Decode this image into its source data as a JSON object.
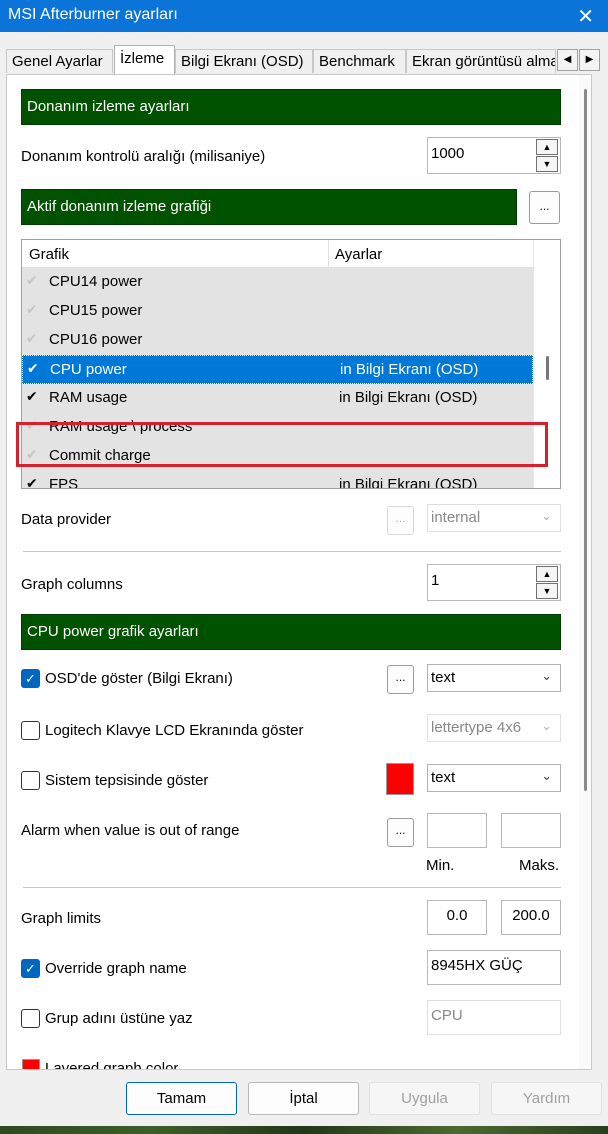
{
  "window": {
    "title": "MSI Afterburner ayarları"
  },
  "tabs": [
    {
      "label": "Genel Ayarlar"
    },
    {
      "label": "İzleme"
    },
    {
      "label": "Bilgi Ekranı (OSD)"
    },
    {
      "label": "Benchmark"
    },
    {
      "label": "Ekran görüntüsü alma"
    }
  ],
  "active_tab": "İzleme",
  "monitoring": {
    "header": "Donanım izleme ayarları",
    "polling_label": "Donanım kontrolü aralığı (milisaniye)",
    "polling_value": "1000"
  },
  "graphs": {
    "header": "Aktif donanım izleme grafiği",
    "more_label": "...",
    "col_graph": "Grafik",
    "col_settings": "Ayarlar",
    "rows": [
      {
        "name": "CPU14 power",
        "setting": "",
        "checked": false
      },
      {
        "name": "CPU15 power",
        "setting": "",
        "checked": false
      },
      {
        "name": "CPU16 power",
        "setting": "",
        "checked": false
      },
      {
        "name": "CPU power",
        "setting": "in Bilgi Ekranı (OSD)",
        "checked": true,
        "selected": true
      },
      {
        "name": "RAM usage",
        "setting": "in Bilgi Ekranı (OSD)",
        "checked": true
      },
      {
        "name": "RAM usage \\ process",
        "setting": "",
        "checked": false
      },
      {
        "name": "Commit charge",
        "setting": "",
        "checked": false
      },
      {
        "name": "FPS",
        "setting": "in Bilgi Ekranı (OSD)",
        "checked": true
      }
    ]
  },
  "data_provider": {
    "label": "Data provider",
    "button": "...",
    "value": "internal"
  },
  "graph_columns": {
    "label": "Graph columns",
    "value": "1"
  },
  "cpu_power": {
    "header": "CPU power grafik ayarları",
    "osd": {
      "label": "OSD'de göster (Bilgi Ekranı)",
      "checked": true,
      "button": "...",
      "value": "text"
    },
    "logitech": {
      "label": "Logitech Klavye LCD Ekranında göster",
      "checked": false,
      "value": "lettertype 4x6"
    },
    "tray": {
      "label": "Sistem tepsisinde göster",
      "checked": false,
      "color": "#ff0000",
      "value": "text"
    },
    "alarm": {
      "label": "Alarm when value is out of range",
      "button": "...",
      "min_label": "Min.",
      "max_label": "Maks.",
      "min_value": "",
      "max_value": ""
    },
    "limits": {
      "label": "Graph limits",
      "min": "0.0",
      "max": "200.0"
    },
    "override": {
      "label": "Override graph name",
      "checked": true,
      "value": "8945HX GÜÇ"
    },
    "group": {
      "label": "Grup adını üstüne yaz",
      "checked": false,
      "value": "CPU"
    },
    "layered": {
      "label": "Layered graph color",
      "color": "#ff0000"
    }
  },
  "footer": {
    "ok": "Tamam",
    "cancel": "İptal",
    "apply": "Uygula",
    "help": "Yardım"
  },
  "colors": {
    "section_header": "#005200",
    "titlebar": "#0a74d8",
    "selection": "#0078d7",
    "highlight_box": "#d6202c",
    "checkbox_checked": "#0067c0"
  }
}
